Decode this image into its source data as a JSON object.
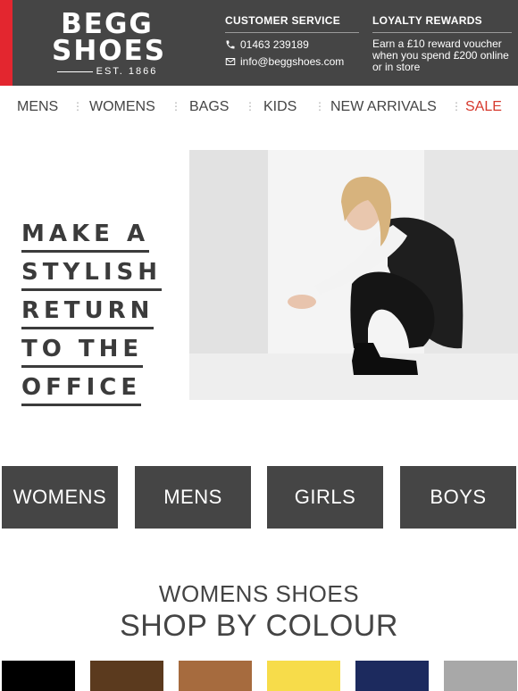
{
  "brand": {
    "line1": "BEGG",
    "line2": "SHOES",
    "est": "EST. 1866",
    "accent_color": "#e3262f"
  },
  "customer_service": {
    "title": "CUSTOMER SERVICE",
    "phone": "01463 239189",
    "email": "info@beggshoes.com",
    "phone_icon": "phone-icon",
    "email_icon": "envelope-icon"
  },
  "loyalty": {
    "title": "LOYALTY REWARDS",
    "text": "Earn a £10 reward voucher when you spend £200 online or in store"
  },
  "nav": {
    "items": [
      "MENS",
      "WOMENS",
      "BAGS",
      "KIDS",
      "NEW ARRIVALS",
      "SALE"
    ],
    "sale_color": "#d6392d"
  },
  "hero": {
    "lines": [
      "MAKE A",
      "STYLISH",
      "RETURN",
      "TO THE",
      "OFFICE"
    ]
  },
  "categories": [
    "WOMENS",
    "MENS",
    "GIRLS",
    "BOYS"
  ],
  "shop_by_colour": {
    "subtitle": "WOMENS SHOES",
    "title": "SHOP BY COLOUR",
    "swatches": [
      "#000000",
      "#5b3a1e",
      "#a66b3e",
      "#f7dc4a",
      "#1c2a5e",
      "#a8a8a8"
    ]
  }
}
